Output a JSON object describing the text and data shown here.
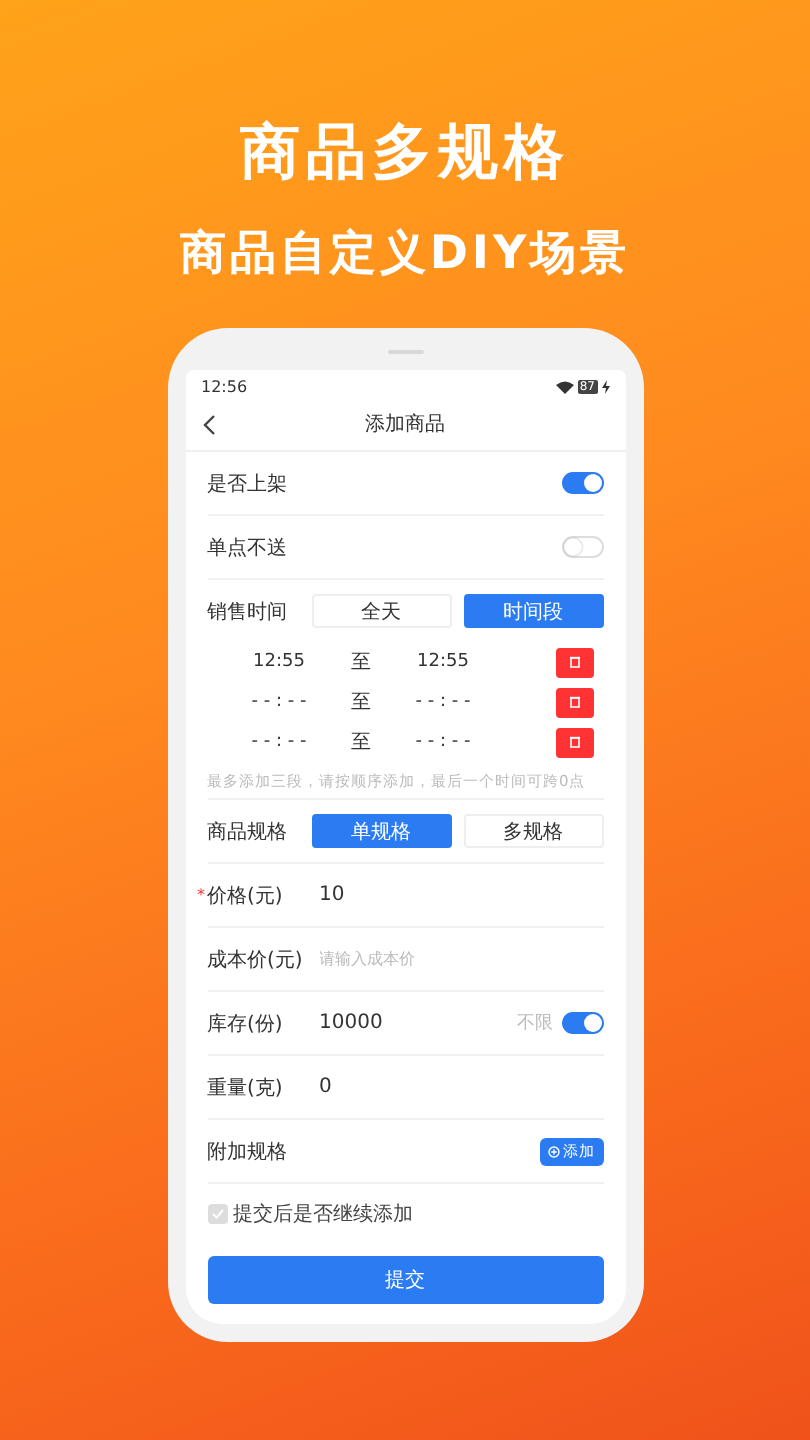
{
  "headline": "商品多规格",
  "subheadline": "商品自定义DIY场景",
  "status_bar": {
    "time": "12:56",
    "battery": "87"
  },
  "nav": {
    "title": "添加商品"
  },
  "toggles": [
    {
      "label": "是否上架",
      "on": true
    },
    {
      "label": "单点不送",
      "on": false
    }
  ],
  "sale_time": {
    "label": "销售时间",
    "options": [
      {
        "label": "全天",
        "selected": false
      },
      {
        "label": "时间段",
        "selected": true
      }
    ],
    "slots": [
      {
        "start": "12:55",
        "to": "至",
        "end": "12:55"
      },
      {
        "start": "- - : - -",
        "to": "至",
        "end": "- - : - -"
      },
      {
        "start": "- - : - -",
        "to": "至",
        "end": "- - : - -"
      }
    ],
    "hint": "最多添加三段，请按顺序添加，最后一个时间可跨0点"
  },
  "spec": {
    "label": "商品规格",
    "options": [
      {
        "label": "单规格",
        "selected": true
      },
      {
        "label": "多规格",
        "selected": false
      }
    ]
  },
  "fields": [
    {
      "label": "价格(元)",
      "required_mark": "*",
      "value": "10"
    },
    {
      "label": "成本价(元)",
      "placeholder": "请输入成本价"
    },
    {
      "label": "库存(份)",
      "value": "10000",
      "unlimited": {
        "label": "不限",
        "on": true
      }
    },
    {
      "label": "重量(克)",
      "value": "0"
    }
  ],
  "extra": {
    "label": "附加规格",
    "button": "添加"
  },
  "continue": {
    "label": "提交后是否继续添加",
    "checked": true
  },
  "submit": "提交"
}
